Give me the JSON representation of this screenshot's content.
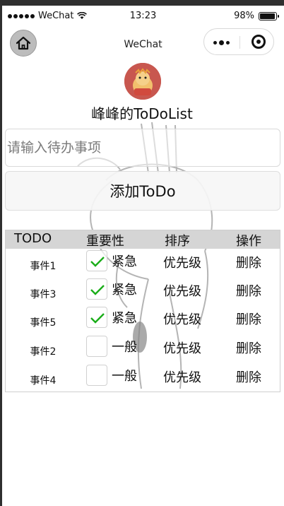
{
  "status_bar": {
    "carrier": "WeChat",
    "time": "13:23",
    "battery_percent": "98%",
    "battery_level": 0.98
  },
  "nav": {
    "title": "WeChat",
    "home_icon": "home-icon",
    "more_icon": "more-dots-icon",
    "close_icon": "target-icon"
  },
  "app": {
    "title": "峰峰的ToDoList",
    "input_placeholder": "请输入待办事项",
    "input_value": "",
    "add_button_label": "添加ToDo"
  },
  "table": {
    "headers": {
      "todo": "TODO",
      "importance": "重要性",
      "order": "排序",
      "action": "操作"
    },
    "rows": [
      {
        "name": "事件1",
        "checked": true,
        "importance": "紧急",
        "priority": "优先级",
        "delete": "删除"
      },
      {
        "name": "事件3",
        "checked": true,
        "importance": "紧急",
        "priority": "优先级",
        "delete": "删除"
      },
      {
        "name": "事件5",
        "checked": true,
        "importance": "紧急",
        "priority": "优先级",
        "delete": "删除"
      },
      {
        "name": "事件2",
        "checked": false,
        "importance": "一般",
        "priority": "优先级",
        "delete": "删除"
      },
      {
        "name": "事件4",
        "checked": false,
        "importance": "一般",
        "priority": "优先级",
        "delete": "删除"
      }
    ]
  },
  "colors": {
    "check": "#1aad19",
    "header_bg": "#d5d5d5",
    "avatar_bg": "#c8574f"
  }
}
